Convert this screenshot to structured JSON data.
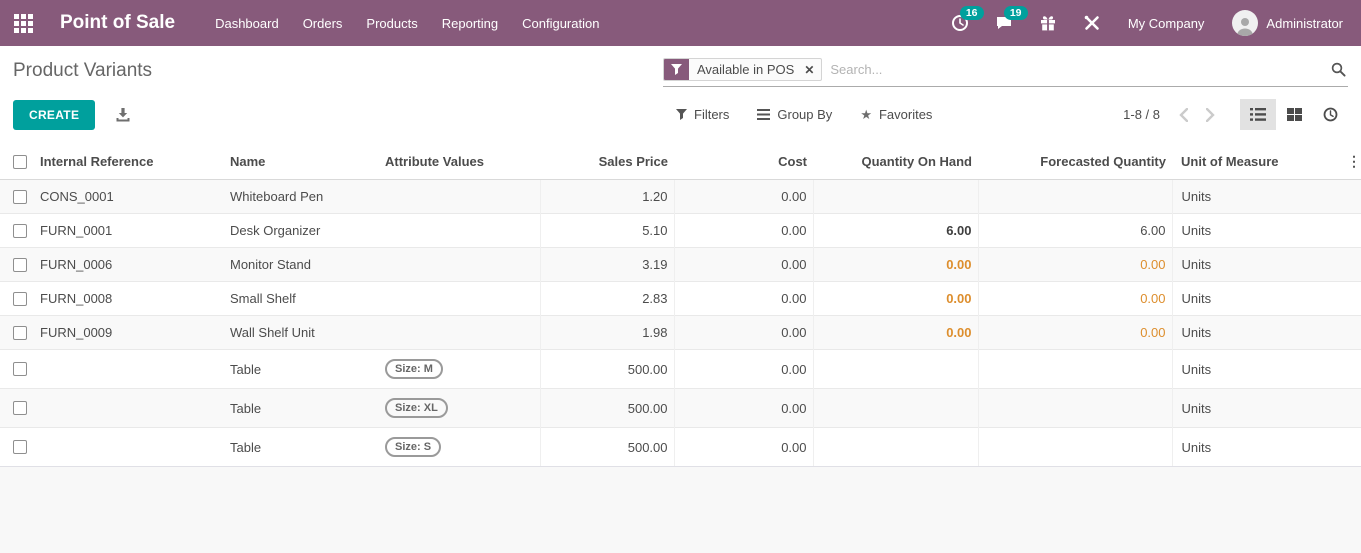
{
  "colors": {
    "navbar_bg": "#875a7b",
    "primary": "#00a09d",
    "badge_bg": "#00a09d",
    "warning": "#dd8e2d"
  },
  "navbar": {
    "brand": "Point of Sale",
    "menus": [
      "Dashboard",
      "Orders",
      "Products",
      "Reporting",
      "Configuration"
    ],
    "activities_badge": "16",
    "messages_badge": "19",
    "company": "My Company",
    "user": "Administrator"
  },
  "control_panel": {
    "title": "Product Variants",
    "create_label": "CREATE",
    "search": {
      "facet_label": "Available in POS",
      "facet_remove": "✕",
      "placeholder": "Search..."
    },
    "filters_label": "Filters",
    "group_by_label": "Group By",
    "favorites_label": "Favorites",
    "favorites_star": "★",
    "pager": "1-8 / 8",
    "optional_columns_icon": "⋮"
  },
  "table": {
    "columns": {
      "ref": "Internal Reference",
      "name": "Name",
      "attr": "Attribute Values",
      "price": "Sales Price",
      "cost": "Cost",
      "qty": "Quantity On Hand",
      "forecast": "Forecasted Quantity",
      "uom": "Unit of Measure"
    },
    "rows": [
      {
        "ref": "CONS_0001",
        "name": "Whiteboard Pen",
        "attr": "",
        "price": "1.20",
        "cost": "0.00",
        "qty": "",
        "forecast": "",
        "uom": "Units",
        "qty_warning": false
      },
      {
        "ref": "FURN_0001",
        "name": "Desk Organizer",
        "attr": "",
        "price": "5.10",
        "cost": "0.00",
        "qty": "6.00",
        "forecast": "6.00",
        "uom": "Units",
        "qty_warning": false
      },
      {
        "ref": "FURN_0006",
        "name": "Monitor Stand",
        "attr": "",
        "price": "3.19",
        "cost": "0.00",
        "qty": "0.00",
        "forecast": "0.00",
        "uom": "Units",
        "qty_warning": true
      },
      {
        "ref": "FURN_0008",
        "name": "Small Shelf",
        "attr": "",
        "price": "2.83",
        "cost": "0.00",
        "qty": "0.00",
        "forecast": "0.00",
        "uom": "Units",
        "qty_warning": true
      },
      {
        "ref": "FURN_0009",
        "name": "Wall Shelf Unit",
        "attr": "",
        "price": "1.98",
        "cost": "0.00",
        "qty": "0.00",
        "forecast": "0.00",
        "uom": "Units",
        "qty_warning": true
      },
      {
        "ref": "",
        "name": "Table",
        "attr": "Size: M",
        "price": "500.00",
        "cost": "0.00",
        "qty": "",
        "forecast": "",
        "uom": "Units",
        "qty_warning": false
      },
      {
        "ref": "",
        "name": "Table",
        "attr": "Size: XL",
        "price": "500.00",
        "cost": "0.00",
        "qty": "",
        "forecast": "",
        "uom": "Units",
        "qty_warning": false
      },
      {
        "ref": "",
        "name": "Table",
        "attr": "Size: S",
        "price": "500.00",
        "cost": "0.00",
        "qty": "",
        "forecast": "",
        "uom": "Units",
        "qty_warning": false
      }
    ]
  }
}
